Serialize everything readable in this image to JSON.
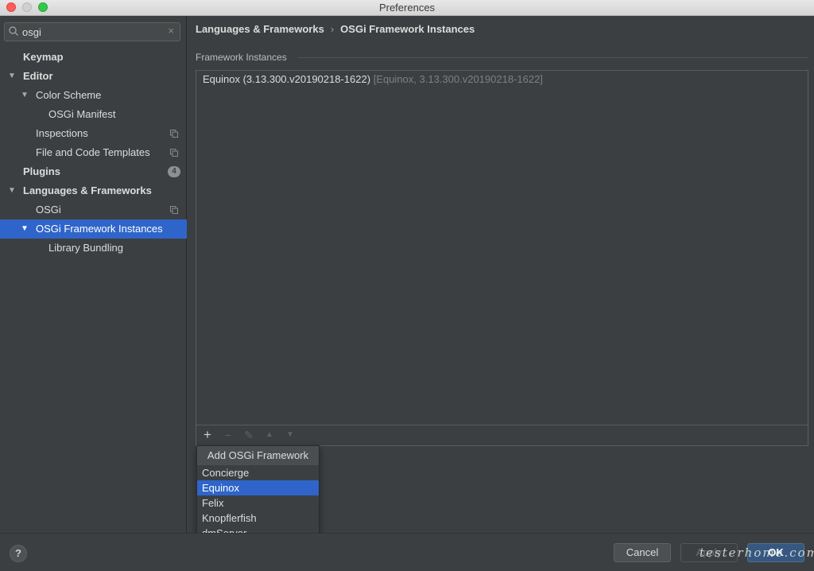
{
  "window": {
    "title": "Preferences"
  },
  "search": {
    "value": "osgi",
    "clear_icon": "×"
  },
  "sidebar": {
    "items": [
      {
        "label": "Keymap"
      },
      {
        "label": "Editor"
      },
      {
        "label": "Color Scheme"
      },
      {
        "label": "OSGi Manifest"
      },
      {
        "label": "Inspections"
      },
      {
        "label": "File and Code Templates"
      },
      {
        "label": "Plugins",
        "badge": "4"
      },
      {
        "label": "Languages & Frameworks"
      },
      {
        "label": "OSGi"
      },
      {
        "label": "OSGi Framework Instances"
      },
      {
        "label": "Library Bundling"
      }
    ]
  },
  "breadcrumb": {
    "parent": "Languages & Frameworks",
    "separator": "›",
    "current": "OSGi Framework Instances"
  },
  "section": {
    "title": "Framework Instances"
  },
  "instances": [
    {
      "name": "Equinox (3.13.300.v20190218-1622)",
      "detail": "[Equinox, 3.13.300.v20190218-1622]"
    }
  ],
  "toolbar": {
    "add": "+",
    "remove": "−",
    "edit": "✎",
    "up": "▲",
    "down": "▼"
  },
  "popup": {
    "title": "Add OSGi Framework",
    "items": [
      "Concierge",
      "Equinox",
      "Felix",
      "Knopflerfish",
      "dmServer"
    ],
    "selected": "Equinox"
  },
  "buttons": {
    "help": "?",
    "cancel": "Cancel",
    "apply": "Apply",
    "ok": "OK"
  },
  "watermark": "testerhome.com",
  "colors": {
    "selection": "#2f65ca",
    "background": "#3c3f41",
    "ok_button": "#365880"
  }
}
